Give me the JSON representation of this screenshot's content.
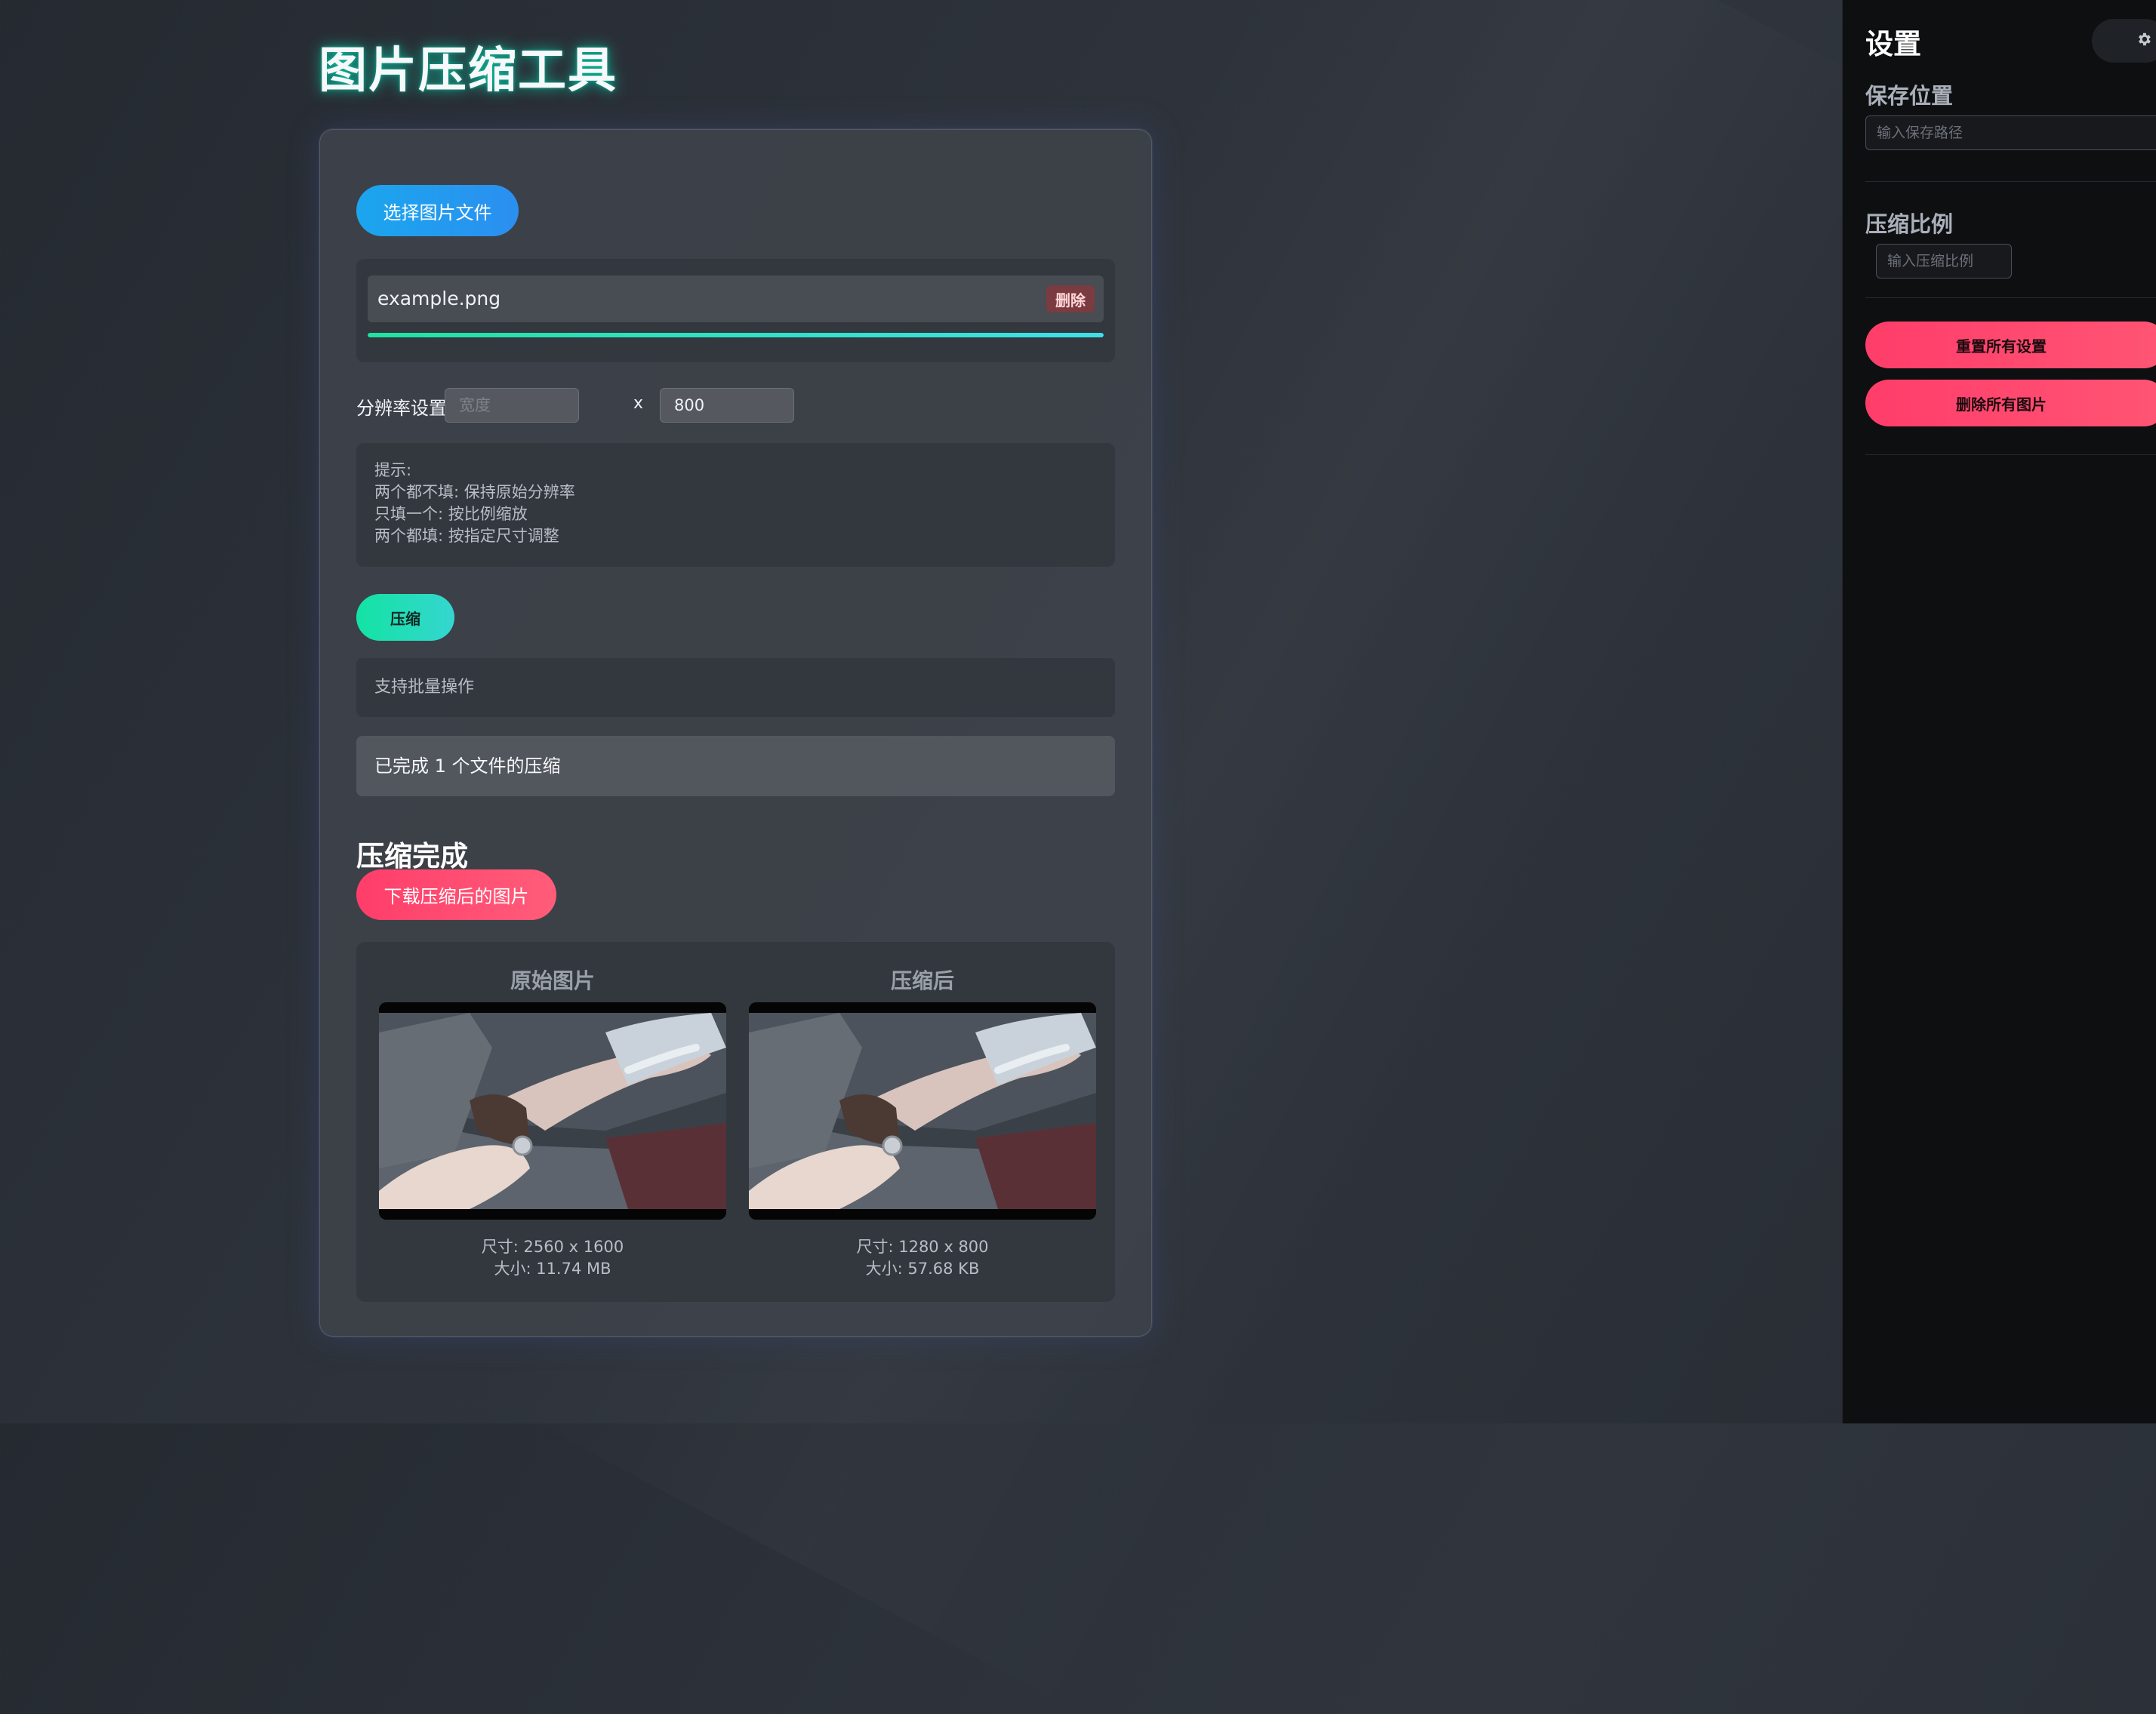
{
  "app": {
    "title": "图片压缩工具"
  },
  "upload": {
    "select_button": "选择图片文件",
    "file": {
      "name": "example.png",
      "delete_label": "删除",
      "progress": 1.0
    }
  },
  "resolution": {
    "label": "分辨率设置:",
    "width_placeholder": "宽度",
    "width_value": "",
    "separator": "x",
    "height_value": "800"
  },
  "tips": {
    "lines": [
      "提示:",
      "两个都不填: 保持原始分辨率",
      "只填一个: 按比例缩放",
      "两个都填: 按指定尺寸调整"
    ]
  },
  "actions": {
    "compress_label": "压缩"
  },
  "info": {
    "batch_text": "支持批量操作",
    "status_text": "已完成 1 个文件的压缩"
  },
  "result": {
    "heading": "压缩完成",
    "download_label": "下载压缩后的图片",
    "original": {
      "title": "原始图片",
      "size_line": "尺寸: 2560 x 1600",
      "filesize_line": "大小: 11.74 MB"
    },
    "compressed": {
      "title": "压缩后",
      "size_line": "尺寸: 1280 x 800",
      "filesize_line": "大小: 57.68 KB"
    }
  },
  "settings": {
    "title": "设置",
    "gear_icon": "gear-icon",
    "save_location": {
      "label": "保存位置",
      "placeholder": "输入保存路径"
    },
    "compression_ratio": {
      "label": "压缩比例",
      "placeholder": "输入压缩比例"
    },
    "reset_label": "重置所有设置",
    "delete_all_label": "删除所有图片"
  },
  "colors": {
    "accent_blue": "#1ba6ee",
    "accent_green": "#13e3a3",
    "accent_pink": "#ff3d6a",
    "title_glow": "#00e6be"
  }
}
